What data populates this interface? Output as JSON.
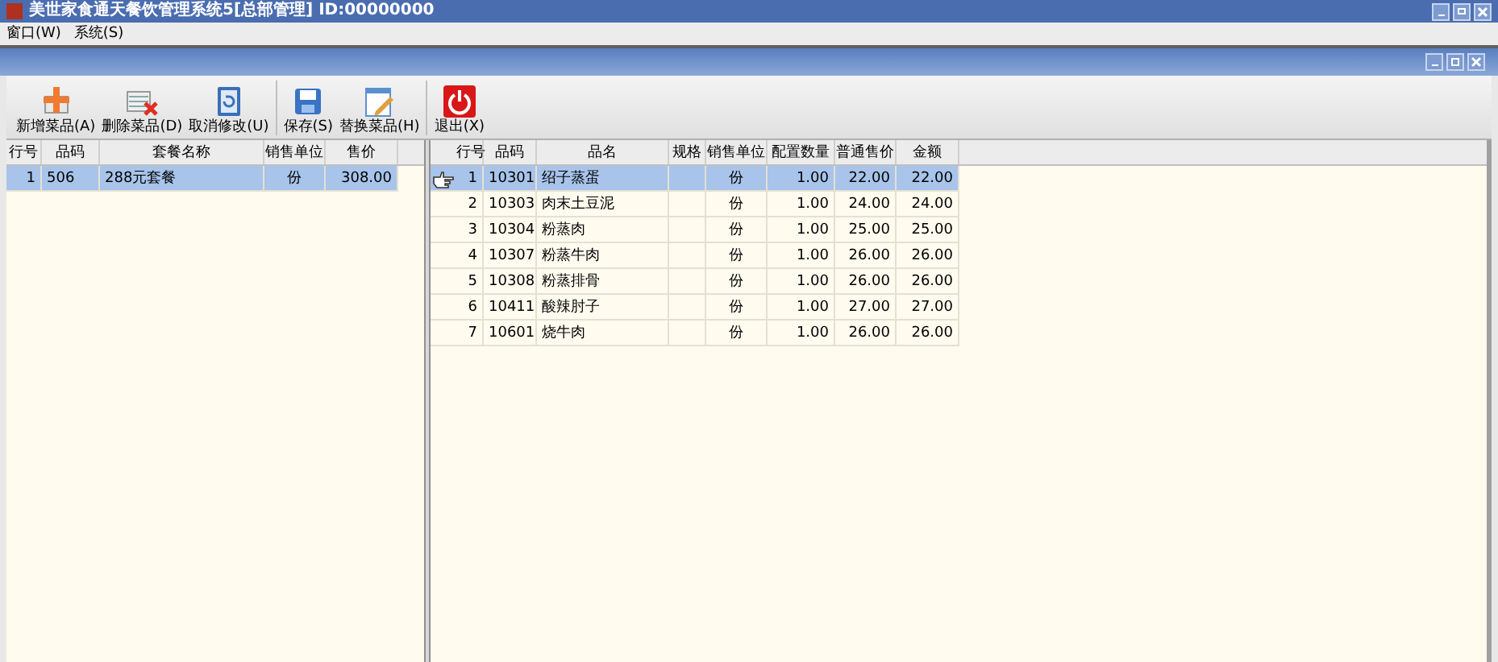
{
  "window": {
    "title": "美世家食通天餐饮管理系统5[总部管理] ID:00000000"
  },
  "menu": [
    {
      "label": "窗口(W)"
    },
    {
      "label": "系统(S)"
    }
  ],
  "toolbar": [
    {
      "label": "新增菜品(A)",
      "kind": "add"
    },
    {
      "label": "删除菜品(D)",
      "kind": "delete"
    },
    {
      "label": "取消修改(U)",
      "kind": "undo"
    },
    {
      "label": "保存(S)",
      "kind": "save"
    },
    {
      "label": "替换菜品(H)",
      "kind": "replace"
    },
    {
      "label": "退出(X)",
      "kind": "exit"
    }
  ],
  "set_table": {
    "columns": [
      "行号",
      "品码",
      "套餐名称",
      "销售单位",
      "售价"
    ],
    "rows": [
      {
        "cells": [
          "1",
          "506",
          "288元套餐",
          "份",
          "308.00"
        ],
        "selected": true
      }
    ]
  },
  "item_table": {
    "columns": [
      "行号",
      "品码",
      "品名",
      "规格",
      "销售单位",
      "配置数量",
      "普通售价",
      "金额"
    ],
    "rows": [
      {
        "cells": [
          "1",
          "10301",
          "绍子蒸蛋",
          "",
          "份",
          "1.00",
          "22.00",
          "22.00"
        ],
        "selected": true
      },
      {
        "cells": [
          "2",
          "10303",
          "肉末土豆泥",
          "",
          "份",
          "1.00",
          "24.00",
          "24.00"
        ],
        "selected": false
      },
      {
        "cells": [
          "3",
          "10304",
          "粉蒸肉",
          "",
          "份",
          "1.00",
          "25.00",
          "25.00"
        ],
        "selected": false
      },
      {
        "cells": [
          "4",
          "10307",
          "粉蒸牛肉",
          "",
          "份",
          "1.00",
          "26.00",
          "26.00"
        ],
        "selected": false
      },
      {
        "cells": [
          "5",
          "10308",
          "粉蒸排骨",
          "",
          "份",
          "1.00",
          "26.00",
          "26.00"
        ],
        "selected": false
      },
      {
        "cells": [
          "6",
          "10411",
          "酸辣肘子",
          "",
          "份",
          "1.00",
          "27.00",
          "27.00"
        ],
        "selected": false
      },
      {
        "cells": [
          "7",
          "10601",
          "烧牛肉",
          "",
          "份",
          "1.00",
          "26.00",
          "26.00"
        ],
        "selected": false
      }
    ]
  }
}
